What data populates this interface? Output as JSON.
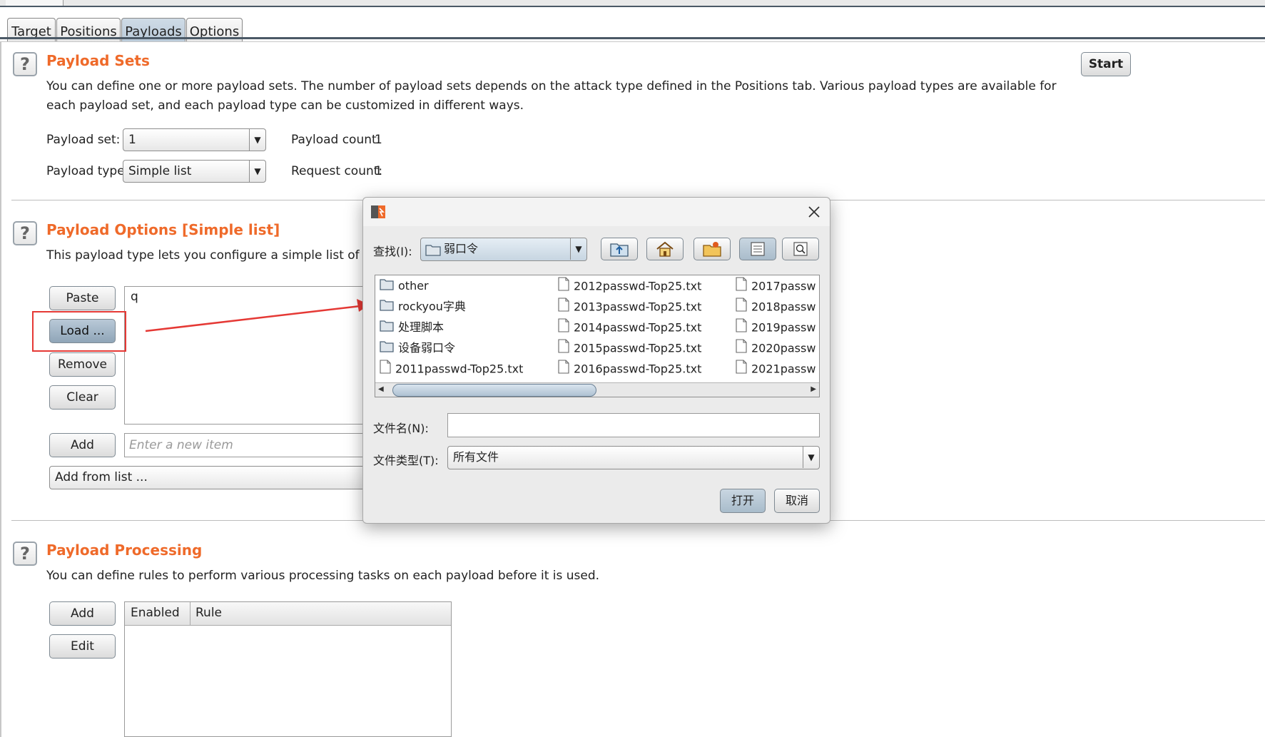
{
  "tabs": [
    {
      "label": "Target"
    },
    {
      "label": "Positions"
    },
    {
      "label": "Payloads"
    },
    {
      "label": "Options"
    }
  ],
  "active_tab": "Payloads",
  "start_button": "Start",
  "payload_sets": {
    "title": "Payload Sets",
    "description": "You can define one or more payload sets. The number of payload sets depends on the attack type defined in the Positions tab. Various payload types are available for each payload set, and each payload type can be customized in different ways.",
    "set_label": "Payload set:",
    "set_value": "1",
    "type_label": "Payload type:",
    "type_value": "Simple list",
    "count_label": "Payload count:",
    "count_value": "1",
    "request_label": "Request count:",
    "request_value": "1"
  },
  "payload_options": {
    "title": "Payload Options [Simple list]",
    "description": "This payload type lets you configure a simple list of strings tha",
    "buttons": {
      "paste": "Paste",
      "load": "Load ...",
      "remove": "Remove",
      "clear": "Clear",
      "add": "Add"
    },
    "list_items": [
      "q"
    ],
    "new_item_placeholder": "Enter a new item",
    "add_from_list": "Add from list ..."
  },
  "payload_processing": {
    "title": "Payload Processing",
    "description": "You can define rules to perform various processing tasks on each payload before it is used.",
    "buttons": {
      "add": "Add",
      "edit": "Edit"
    },
    "columns": [
      "Enabled",
      "Rule"
    ]
  },
  "dialog": {
    "look_in_label": "查找(I):",
    "look_in_value": "弱口令",
    "files_col1": [
      {
        "name": "other",
        "kind": "folder"
      },
      {
        "name": "rockyou字典",
        "kind": "folder"
      },
      {
        "name": "处理脚本",
        "kind": "folder"
      },
      {
        "name": "设备弱口令",
        "kind": "folder"
      },
      {
        "name": "2011passwd-Top25.txt",
        "kind": "file"
      }
    ],
    "files_col2": [
      {
        "name": "2012passwd-Top25.txt",
        "kind": "file"
      },
      {
        "name": "2013passwd-Top25.txt",
        "kind": "file"
      },
      {
        "name": "2014passwd-Top25.txt",
        "kind": "file"
      },
      {
        "name": "2015passwd-Top25.txt",
        "kind": "file"
      },
      {
        "name": "2016passwd-Top25.txt",
        "kind": "file"
      }
    ],
    "files_col3": [
      {
        "name": "2017passw",
        "kind": "file"
      },
      {
        "name": "2018passw",
        "kind": "file"
      },
      {
        "name": "2019passw",
        "kind": "file"
      },
      {
        "name": "2020passw",
        "kind": "file"
      },
      {
        "name": "2021passw",
        "kind": "file"
      }
    ],
    "filename_label": "文件名(N):",
    "filename_value": "",
    "filetype_label": "文件类型(T):",
    "filetype_value": "所有文件",
    "open_button": "打开",
    "cancel_button": "取消"
  },
  "colors": {
    "accent": "#ef6a2a",
    "highlight_box": "#e53935"
  }
}
